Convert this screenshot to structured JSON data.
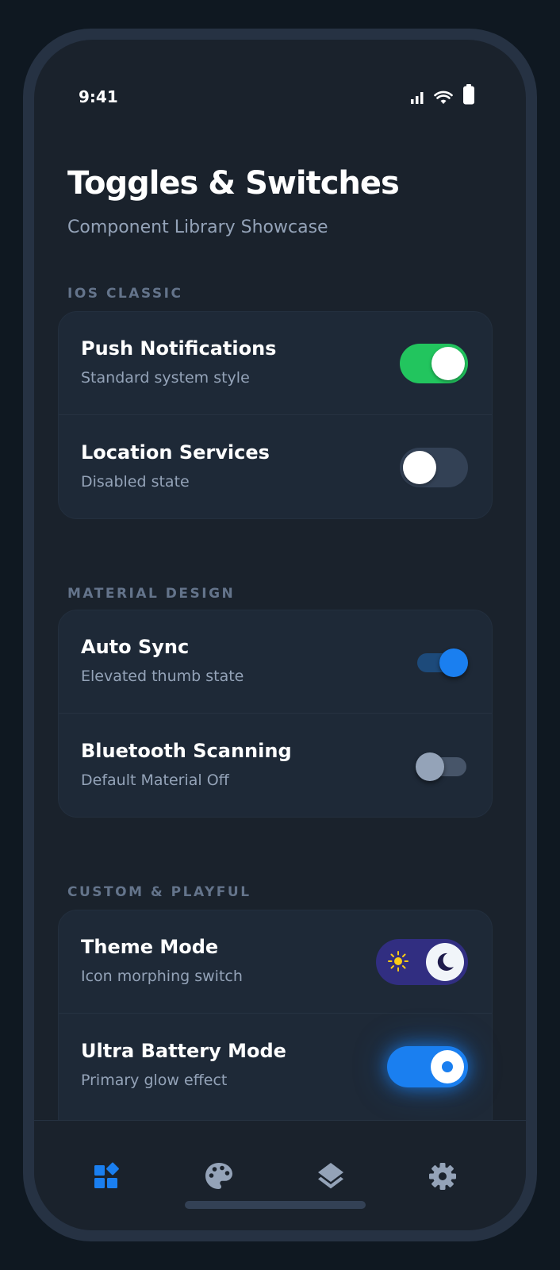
{
  "status_bar": {
    "time": "9:41"
  },
  "header": {
    "title": "Toggles & Switches",
    "subtitle": "Component Library Showcase"
  },
  "sections": [
    {
      "label": "IOS CLASSIC",
      "items": [
        {
          "title": "Push Notifications",
          "subtitle": "Standard system style",
          "state": "on"
        },
        {
          "title": "Location Services",
          "subtitle": "Disabled state",
          "state": "off"
        }
      ]
    },
    {
      "label": "MATERIAL DESIGN",
      "items": [
        {
          "title": "Auto Sync",
          "subtitle": "Elevated thumb state",
          "state": "on"
        },
        {
          "title": "Bluetooth Scanning",
          "subtitle": "Default Material Off",
          "state": "off"
        }
      ]
    },
    {
      "label": "CUSTOM & PLAYFUL",
      "items": [
        {
          "title": "Theme Mode",
          "subtitle": "Icon morphing switch",
          "state": "dark"
        },
        {
          "title": "Ultra Battery Mode",
          "subtitle": "Primary glow effect",
          "state": "on"
        }
      ]
    }
  ],
  "bottom_nav": {
    "items": [
      {
        "icon": "widgets-icon",
        "active": true
      },
      {
        "icon": "palette-icon",
        "active": false
      },
      {
        "icon": "layers-icon",
        "active": false
      },
      {
        "icon": "settings-gear-icon",
        "active": false
      }
    ]
  },
  "colors": {
    "accent": "#1a7ff0",
    "ios_on": "#22c55e",
    "background": "#1a222c",
    "card": "#1e2937"
  }
}
